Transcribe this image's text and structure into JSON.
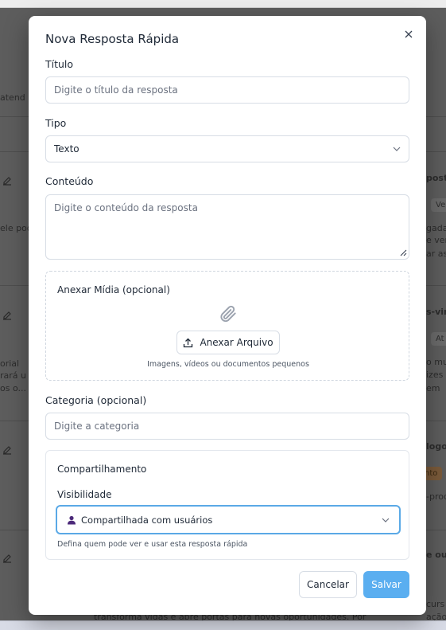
{
  "background": {
    "left_fragments": [
      "atend",
      "ele pod",
      "orial",
      "rará u",
      "os o..."
    ],
    "right_fragments": [
      "posta",
      "Ve",
      "gada",
      "e ver",
      "ar as",
      "s-vin",
      "At",
      "o mu",
      "izes",
      "em",
      "logo",
      "nto",
      "-prod",
      "e ou",
      "curs",
      "ação"
    ],
    "bottom_fragment": "transforma vidas e abre portas para novas oportunidades. Por"
  },
  "modal": {
    "title": "Nova Resposta Rápida",
    "fields": {
      "title_label": "Título",
      "title_placeholder": "Digite o título da resposta",
      "type_label": "Tipo",
      "type_value": "Texto",
      "content_label": "Conteúdo",
      "content_placeholder": "Digite o conteúdo da resposta",
      "category_label": "Categoria (opcional)",
      "category_placeholder": "Digite a categoria"
    },
    "attach": {
      "title": "Anexar Mídia (opcional)",
      "button": "Anexar Arquivo",
      "hint": "Imagens, vídeos ou documentos pequenos"
    },
    "sharing": {
      "title": "Compartilhamento",
      "visibility_label": "Visibilidade",
      "visibility_value": "Compartilhada com usuários",
      "hint": "Defina quem pode ver e usar esta resposta rápida"
    },
    "actions": {
      "cancel": "Cancelar",
      "save": "Salvar"
    },
    "colors": {
      "accent": "#5aaef0",
      "focus_border": "#5aa9e6",
      "user_icon": "#4c2a7a"
    }
  }
}
